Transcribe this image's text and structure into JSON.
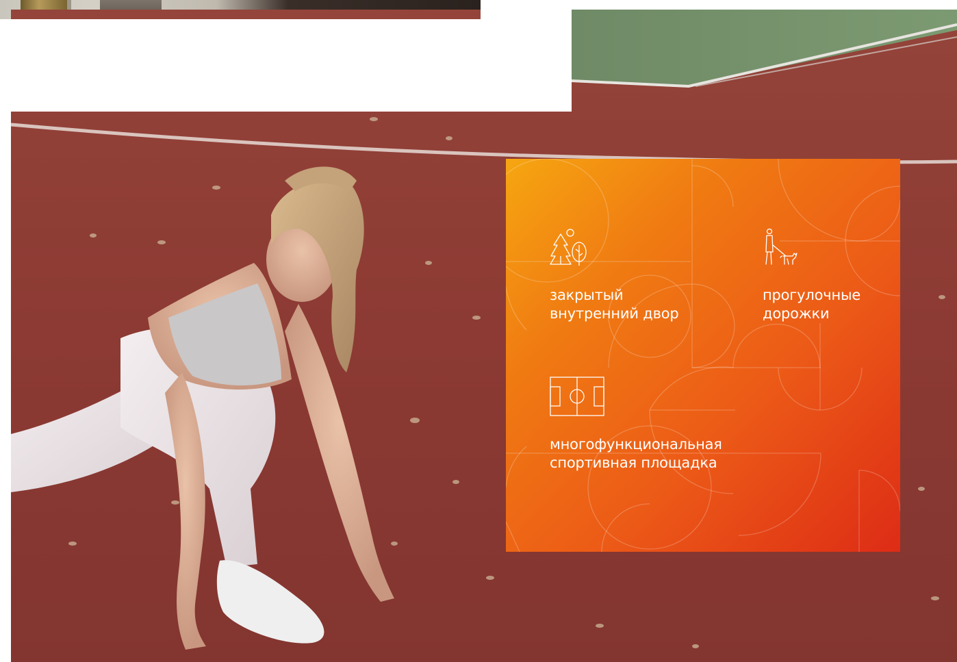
{
  "features": [
    {
      "icon": "trees-icon",
      "line1": "закрытый",
      "line2": "внутренний двор"
    },
    {
      "icon": "walking-dog-icon",
      "line1": "прогулочные",
      "line2": "дорожки"
    },
    {
      "icon": "sports-field-icon",
      "line1": "многофункциональная",
      "line2": "спортивная площадка"
    }
  ],
  "colors": {
    "card_gradient_start": "#f6a611",
    "card_gradient_end": "#dd2c16",
    "track": "#8f3d36",
    "text": "#ffffff"
  }
}
